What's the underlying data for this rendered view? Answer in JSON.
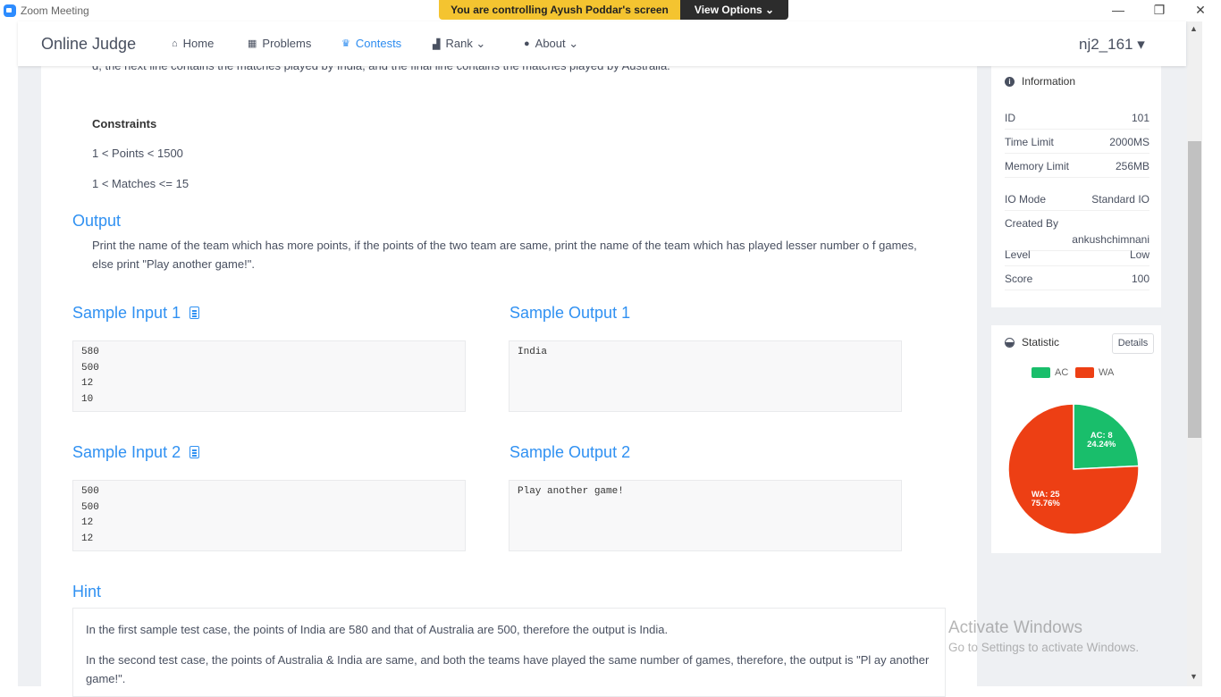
{
  "window": {
    "title": "Zoom Meeting",
    "banner_text": "You are controlling Ayush Poddar's screen",
    "view_options": "View Options ⌄",
    "minimize": "—",
    "maximize": "❐",
    "close": "✕"
  },
  "nav": {
    "brand": "Online Judge",
    "items": [
      {
        "label": "Home",
        "icon": "home-icon"
      },
      {
        "label": "Problems",
        "icon": "grid-icon"
      },
      {
        "label": "Contests",
        "icon": "trophy-icon"
      },
      {
        "label": "Rank ⌄",
        "icon": "bar-chart-icon"
      },
      {
        "label": "About ⌄",
        "icon": "info-icon"
      }
    ],
    "user": "nj2_161 ▾",
    "active_color": "#2d8cf0"
  },
  "problem": {
    "cut_line": "d, the next line contains the matches played by India, and the final line contains the matches played by Australia.",
    "constraints_title": "Constraints",
    "constraints": [
      "1 < Points < 1500",
      "1 < Matches <= 15"
    ],
    "output_title": "Output",
    "output_text": "Print the name of the team which has more points, if the points of the two team are same, print the name of the team which has played lesser number o f games, else print \"Play another game!\".",
    "samples": [
      {
        "input_title": "Sample Input 1",
        "output_title": "Sample Output 1",
        "input_lines": [
          "580",
          "500",
          "12",
          "10"
        ],
        "output_lines": [
          "India"
        ]
      },
      {
        "input_title": "Sample Input 2",
        "output_title": "Sample Output 2",
        "input_lines": [
          "500",
          "500",
          "12",
          "12"
        ],
        "output_lines": [
          "Play another game!"
        ]
      }
    ],
    "hint_title": "Hint",
    "hint_lines": [
      "In the first sample test case, the points of India are 580 and that of Australia are 500, therefore the output is India.",
      "In the second test case, the points of Australia & India are same, and both the teams have played the same number of games, therefore, the output is \"Pl ay another game!\"."
    ]
  },
  "information": {
    "title": "Information",
    "rows": [
      {
        "label": "ID",
        "value": "101"
      },
      {
        "label": "Time Limit",
        "value": "2000MS"
      },
      {
        "label": "Memory Limit",
        "value": "256MB"
      },
      {
        "label": "IO Mode",
        "value": "Standard IO"
      },
      {
        "label": "Created By",
        "value": "ankushchimnani"
      },
      {
        "label": "Level",
        "value": "Low"
      },
      {
        "label": "Score",
        "value": "100"
      }
    ]
  },
  "statistic": {
    "title": "Statistic",
    "details_label": "Details",
    "legend": [
      {
        "label": "AC",
        "color": "#19be6b"
      },
      {
        "label": "WA",
        "color": "#ed3f14"
      }
    ]
  },
  "chart_data": {
    "type": "pie",
    "series": [
      {
        "name": "AC",
        "value": 8,
        "percent": "24.24%",
        "color": "#19be6b"
      },
      {
        "name": "WA",
        "value": 25,
        "percent": "75.76%",
        "color": "#ed3f14"
      }
    ],
    "labels": [
      "AC: 8",
      "24.24%",
      "WA: 25",
      "75.76%"
    ],
    "legend": "top"
  },
  "watermark": {
    "line1": "Activate Windows",
    "line2": "Go to Settings to activate Windows."
  }
}
